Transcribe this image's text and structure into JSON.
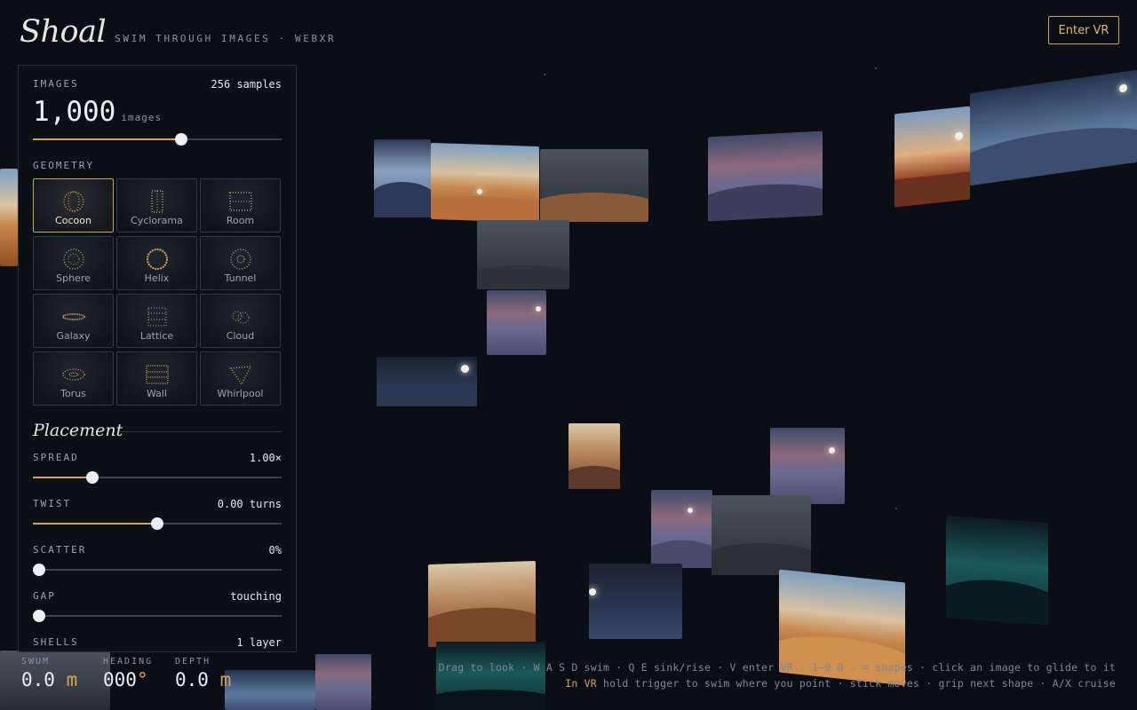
{
  "app": {
    "name": "Shoal",
    "tagline": "SWIM THROUGH IMAGES · WEBXR"
  },
  "header": {
    "enter_vr_label": "Enter VR"
  },
  "panel": {
    "images": {
      "label": "IMAGES",
      "samples": "256 samples",
      "count": "1,000",
      "unit": "images",
      "slider_fraction": 0.595
    },
    "geometry": {
      "label": "GEOMETRY",
      "selected": "Cocoon",
      "items": [
        {
          "label": "Cocoon",
          "icon": "cocoon-icon"
        },
        {
          "label": "Cyclorama",
          "icon": "cyclorama-icon"
        },
        {
          "label": "Room",
          "icon": "room-icon"
        },
        {
          "label": "Sphere",
          "icon": "sphere-icon"
        },
        {
          "label": "Helix",
          "icon": "helix-icon"
        },
        {
          "label": "Tunnel",
          "icon": "tunnel-icon"
        },
        {
          "label": "Galaxy",
          "icon": "galaxy-icon"
        },
        {
          "label": "Lattice",
          "icon": "lattice-icon"
        },
        {
          "label": "Cloud",
          "icon": "cloud-icon"
        },
        {
          "label": "Torus",
          "icon": "torus-icon"
        },
        {
          "label": "Wall",
          "icon": "wall-icon"
        },
        {
          "label": "Whirlpool",
          "icon": "whirlpool-icon"
        }
      ]
    },
    "placement": {
      "title": "Placement",
      "spread": {
        "label": "SPREAD",
        "value": "1.00×",
        "fraction": 0.24
      },
      "twist": {
        "label": "TWIST",
        "value": "0.00 turns",
        "fraction": 0.5
      },
      "scatter": {
        "label": "SCATTER",
        "value": "0%",
        "fraction": 0
      },
      "gap": {
        "label": "GAP",
        "value": "touching",
        "fraction": 0
      },
      "shells": {
        "label": "SHELLS",
        "value": "1 layer"
      }
    }
  },
  "hud": {
    "swum": {
      "label": "SWUM",
      "value": "0.0",
      "unit": "m"
    },
    "heading": {
      "label": "HEADING",
      "value": "000",
      "unit": "°"
    },
    "depth": {
      "label": "DEPTH",
      "value": "0.0",
      "unit": "m"
    }
  },
  "hints": {
    "line1": "Drag to look · W A S D swim · Q E sink/rise · V enter VR · 1–9 0 - = shapes · click an image to glide to it",
    "line2_accent": "In VR",
    "line2_rest": " hold trigger to swim where you point · stick moves · grip next shape · A/X cruise"
  },
  "colors": {
    "accent": "#d4a35e",
    "background": "#0b0f15",
    "panel": "#0c1016"
  }
}
